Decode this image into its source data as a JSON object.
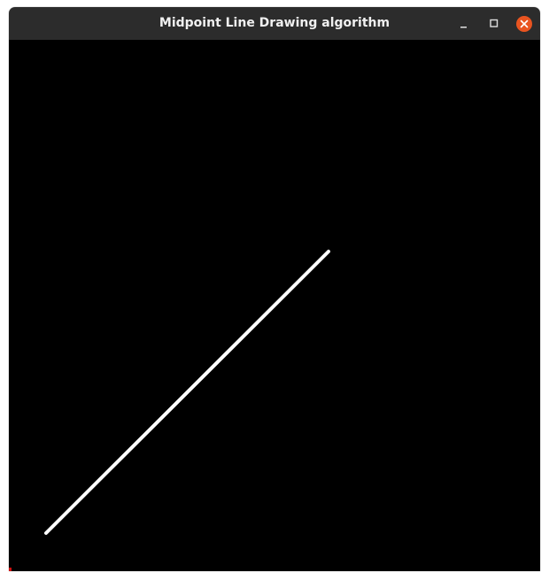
{
  "window": {
    "title": "Midpoint Line Drawing algorithm"
  },
  "controls": {
    "minimize_icon": "minimize-icon",
    "maximize_icon": "maximize-icon",
    "close_icon": "close-icon",
    "close_color": "#e95420"
  },
  "canvas": {
    "background": "#000000",
    "line_color": "#ffffff"
  }
}
